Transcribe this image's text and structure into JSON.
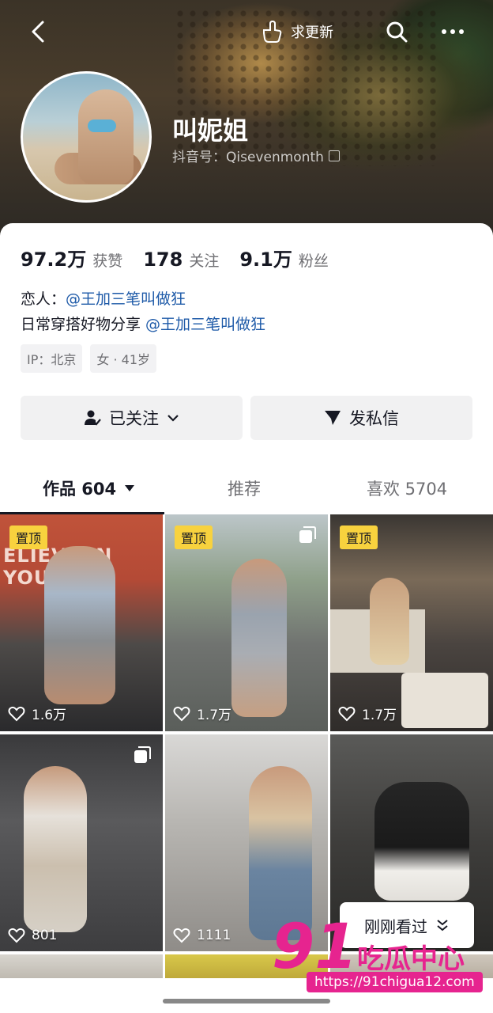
{
  "header": {
    "update_label": "求更新"
  },
  "profile": {
    "name": "叫妮姐",
    "douyin_id": "抖音号：Qisevenmonth"
  },
  "stats": [
    {
      "num": "97.2万",
      "label": "获赞"
    },
    {
      "num": "178",
      "label": "关注"
    },
    {
      "num": "9.1万",
      "label": "粉丝"
    }
  ],
  "bio": {
    "line1_prefix": "恋人：",
    "line1_mention": "@王加三笔叫做狂",
    "line2_prefix": "日常穿搭好物分享 ",
    "line2_mention": "@王加三笔叫做狂"
  },
  "tags": [
    "IP：北京",
    "女 · 41岁"
  ],
  "buttons": {
    "follow": "已关注",
    "message": "发私信"
  },
  "tabs": {
    "works": "作品 604",
    "recommend": "推荐",
    "likes": "喜欢 5704"
  },
  "videos": [
    {
      "pinned": "置顶",
      "likes": "1.6万",
      "multi": false
    },
    {
      "pinned": "置顶",
      "likes": "1.7万",
      "multi": true
    },
    {
      "pinned": "置顶",
      "likes": "1.7万",
      "multi": false
    },
    {
      "pinned": "",
      "likes": "801",
      "multi": true
    },
    {
      "pinned": "",
      "likes": "1111",
      "multi": false
    },
    {
      "pinned": "",
      "likes": "",
      "multi": false
    }
  ],
  "tile_texts": {
    "tile0_banner": "ELIEVE IN YOU"
  },
  "watched": "刚刚看过",
  "watermark": {
    "num": "91",
    "text": "吃瓜中心",
    "url": "https://91chigua12.com"
  }
}
